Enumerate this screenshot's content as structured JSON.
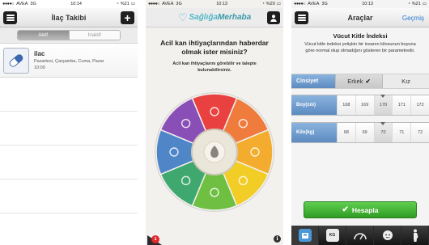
{
  "status_bar": {
    "carrier": "AVEA",
    "network": "3G",
    "battery": "%21",
    "battery_s2": "%20",
    "times": [
      "10:14",
      "10:13",
      "10:13"
    ]
  },
  "screen1": {
    "title": "İlaç Takibi",
    "segments": [
      "Aktif",
      "İnaktif"
    ],
    "drug": {
      "name": "ilac",
      "days": "Pazartesi, Çarşamba, Cuma, Pazar",
      "time": "10:00"
    }
  },
  "screen2": {
    "brand_part1": "Sağlığa",
    "brand_part2": "Merhaba",
    "question": "Acil kan ihtiyaçlarından haberdar olmak ister misiniz?",
    "subtext": "Acil kan ihtiyaçlarını görebilir ve talepte bulunabilirsiniz.",
    "badge_count": "1",
    "info_glyph": "i",
    "wheel_colors": [
      "#e84140",
      "#ef7b3c",
      "#f3ac2e",
      "#f2cd25",
      "#6fbf42",
      "#3fa86e",
      "#4f86c8",
      "#8a4fb7"
    ]
  },
  "screen3": {
    "title": "Araçlar",
    "back_label": "Geçmiş",
    "bmi_title": "Vücut Kitle İndeksi",
    "bmi_description": "Vücut kitle indeksi yetişkin bir insanın kilosunun boyuna göre normal olup olmadığını gösteren bir parametredir.",
    "gender_label": "Cinsiyet",
    "gender_options": [
      "Erkek",
      "Kız"
    ],
    "height_label": "Boy(cm)",
    "height_values": [
      "168",
      "169",
      "170",
      "171",
      "172"
    ],
    "weight_label": "Kilo(kg)",
    "weight_values": [
      "68",
      "69",
      "70",
      "71",
      "72"
    ],
    "calculate_label": "Hesapla",
    "kg_glyph": "KG",
    "accent": "#4a98d8"
  }
}
